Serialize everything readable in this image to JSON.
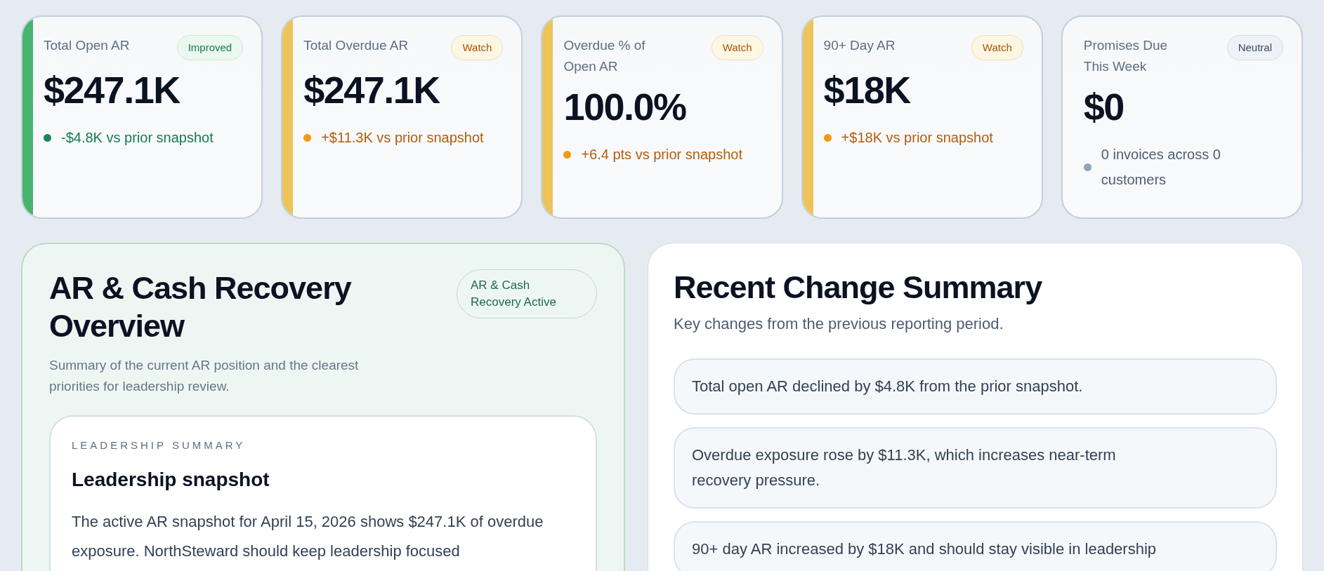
{
  "kpi_cards": [
    {
      "label": "Total Open AR",
      "badge": "Improved",
      "kind": "improved",
      "value": "$247.1K",
      "delta": "-$4.8K vs prior snapshot"
    },
    {
      "label": "Total Overdue AR",
      "badge": "Watch",
      "kind": "watch",
      "value": "$247.1K",
      "delta": "+$11.3K vs prior snapshot"
    },
    {
      "label": "Overdue % of Open AR",
      "badge": "Watch",
      "kind": "watch",
      "value": "100.0%",
      "delta": "+6.4 pts vs prior snapshot"
    },
    {
      "label": "90+ Day AR",
      "badge": "Watch",
      "kind": "watch",
      "value": "$18K",
      "delta": "+$18K vs prior snapshot"
    },
    {
      "label": "Promises Due This Week",
      "badge": "Neutral",
      "kind": "neutral",
      "value": "$0",
      "delta": "0 invoices across 0 customers"
    }
  ],
  "overview": {
    "title": "AR & Cash Recovery Overview",
    "badge": "AR & Cash Recovery Active",
    "subtitle": "Summary of the current AR position and the clearest priorities for leadership review.",
    "summary_card": {
      "eyebrow": "LEADERSHIP SUMMARY",
      "heading": "Leadership snapshot",
      "body": "The active AR snapshot for April 15, 2026 shows $247.1K of overdue exposure. NorthSteward should keep leadership focused"
    }
  },
  "recent_changes": {
    "title": "Recent Change Summary",
    "subtitle": "Key changes from the previous reporting period.",
    "items": [
      "Total open AR declined by $4.8K from the prior snapshot.",
      "Overdue exposure rose by $11.3K, which increases near-term recovery pressure.",
      "90+ day AR increased by $18K and should stay visible in leadership"
    ]
  }
}
